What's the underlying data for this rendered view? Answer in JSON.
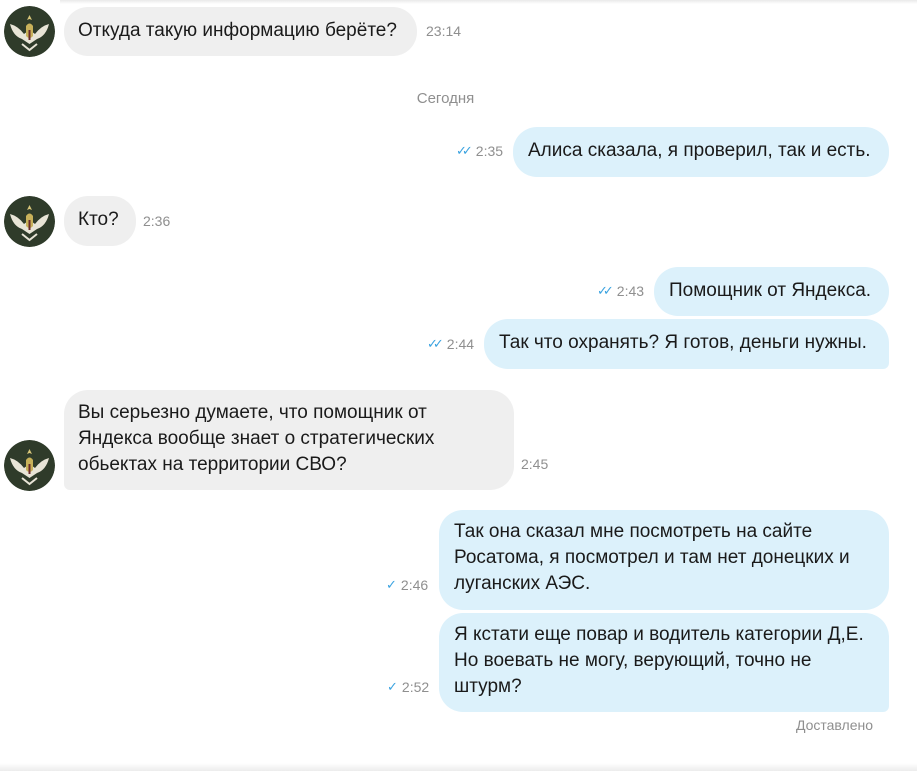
{
  "colors": {
    "incoming_bubble": "#efefef",
    "outgoing_bubble": "#dcf1fb",
    "check_mark": "#3ba3e0",
    "meta_text": "#8f8f8f"
  },
  "avatar_icon": "eagle-emblem-icon",
  "date_separator": "Сегодня",
  "messages": [
    {
      "direction": "in",
      "text": "Откуда такую информацию берёте?",
      "time": "23:14"
    },
    {
      "direction": "out",
      "text": "Алиса сказала, я проверил, так и есть.",
      "time": "2:35",
      "read": true
    },
    {
      "direction": "in",
      "text": "Кто?",
      "time": "2:36"
    },
    {
      "direction": "out",
      "text": "Помощник от Яндекса.",
      "time": "2:43",
      "read": true
    },
    {
      "direction": "out",
      "text": "Так что охранять? Я готов, деньги нужны.",
      "time": "2:44",
      "read": true
    },
    {
      "direction": "in",
      "text": "Вы серьезно думаете, что помощник от\nЯндекса вообще знает о стратегических\nобьектах на территории СВО?",
      "time": "2:45"
    },
    {
      "direction": "out",
      "text": "Так она сказал мне посмотреть на сайте\nРосатома, я посмотрел и там нет донецких и\nлуганских АЭС.",
      "time": "2:46",
      "read": false
    },
    {
      "direction": "out",
      "text": "Я кстати еще повар и водитель категории Д,Е.\nНо воевать не могу, верующий, точно не\nштурм?",
      "time": "2:52",
      "read": false
    }
  ],
  "status_text": "Доставлено",
  "glyphs": {
    "double_check": "✓✓",
    "single_check": "✓"
  }
}
